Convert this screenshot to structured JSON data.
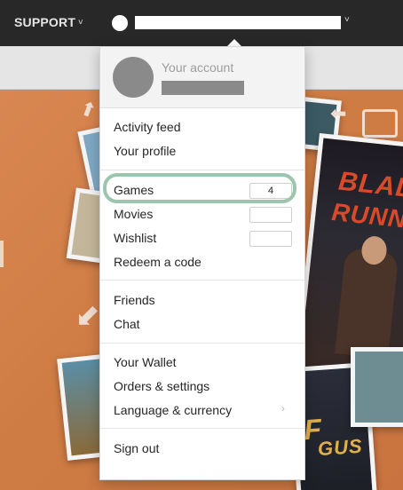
{
  "header": {
    "support_label": "SUPPORT",
    "chevron_glyph": "˅",
    "user_chevron_glyph": "˅"
  },
  "account": {
    "label": "Your account"
  },
  "menu": {
    "activity_feed": "Activity feed",
    "your_profile": "Your profile",
    "games": "Games",
    "games_count": "4",
    "movies": "Movies",
    "wishlist": "Wishlist",
    "redeem": "Redeem a code",
    "friends": "Friends",
    "chat": "Chat",
    "wallet": "Your Wallet",
    "orders": "Orders & settings",
    "language": "Language & currency",
    "language_arrow": "›",
    "sign_out": "Sign out"
  },
  "art": {
    "title_a": "BLADE",
    "title_b": "RUNNER",
    "title_c": "F",
    "title_d": "GUS"
  },
  "colors": {
    "topbar": "#282828",
    "highlight_ring": "#9cc5ae",
    "hero_orange": "#d98752"
  }
}
